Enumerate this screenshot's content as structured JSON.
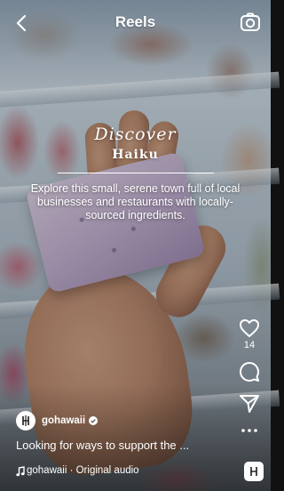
{
  "header": {
    "title": "Reels"
  },
  "overlay": {
    "heading": "Discover",
    "place": "Haiku",
    "description": "Explore this small, serene town full of local businesses and restaurants with locally-sourced ingredients."
  },
  "actions": {
    "like_count": "14"
  },
  "post": {
    "username": "gohawaii",
    "caption": "Looking for ways to support the ...",
    "audio": "gohawaii · Original audio"
  }
}
